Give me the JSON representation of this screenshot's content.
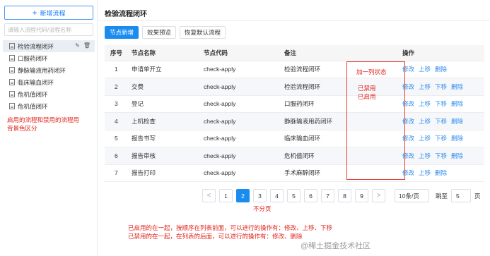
{
  "sidebar": {
    "add_button": "新增流程",
    "search_placeholder": "请输入流程代码/流程名称",
    "items": [
      {
        "label": "检验流程闭环"
      },
      {
        "label": "口服药闭环"
      },
      {
        "label": "静脉输液用药闭环"
      },
      {
        "label": "临床输血闭环"
      },
      {
        "label": "危机值闭环"
      },
      {
        "label": "危机值闭环"
      }
    ],
    "note": "启用的流程和禁用的流程用背景色区分"
  },
  "main": {
    "title": "检验流程闭环",
    "toolbar": {
      "add": "节点新增",
      "preview": "效果预览",
      "restore": "恢复默认流程"
    },
    "table": {
      "headers": {
        "no": "序号",
        "name": "节点名称",
        "code": "节点代码",
        "note": "备注",
        "ops": "操作"
      },
      "rows": [
        {
          "no": "1",
          "name": "申请单开立",
          "code": "check-apply",
          "note": "检验流程闭环",
          "ops": [
            "修改",
            "上移",
            "删除"
          ]
        },
        {
          "no": "2",
          "name": "交费",
          "code": "check-apply",
          "note": "检验流程闭环",
          "ops": [
            "修改",
            "上移",
            "下移",
            "删除"
          ]
        },
        {
          "no": "3",
          "name": "登记",
          "code": "check-apply",
          "note": "口服药闭环",
          "ops": [
            "修改",
            "上移",
            "下移",
            "删除"
          ]
        },
        {
          "no": "4",
          "name": "上机检查",
          "code": "check-apply",
          "note": "静脉输液用药闭环",
          "ops": [
            "修改",
            "上移",
            "下移",
            "删除"
          ]
        },
        {
          "no": "5",
          "name": "报告书写",
          "code": "check-apply",
          "note": "临床输血闭环",
          "ops": [
            "修改",
            "上移",
            "下移",
            "删除"
          ]
        },
        {
          "no": "6",
          "name": "报告审核",
          "code": "check-apply",
          "note": "危机值闭环",
          "ops": [
            "修改",
            "上移",
            "下移",
            "删除"
          ]
        },
        {
          "no": "7",
          "name": "报告打印",
          "code": "check-apply",
          "note": "手术麻醉闭环",
          "ops": [
            "修改",
            "上移",
            "删除"
          ]
        }
      ]
    },
    "annotations": {
      "status_col": "加一列状态",
      "disabled": "已禁用",
      "enabled": "已启用",
      "no_paging": "不分页",
      "bottom_line1": "已启用的在一起，按顺序在列表前面，可以进行的操作有：修改、上移、下移",
      "bottom_line2": "已禁用的在一起，在列表的后面，可以进行的操作有：修改、删除"
    },
    "pagination": {
      "prev": "<",
      "pages": [
        "1",
        "2",
        "3",
        "4",
        "5",
        "6",
        "7",
        "8",
        "9"
      ],
      "current": "2",
      "next": ">",
      "page_size": "10条/页",
      "goto_label": "跳至",
      "goto_value": "5",
      "goto_suffix": "页"
    }
  },
  "watermark": "@稀土掘金技术社区",
  "colors": {
    "primary": "#1a8cf0",
    "annotation_red": "#e0241b",
    "link": "#2a8cf2"
  }
}
